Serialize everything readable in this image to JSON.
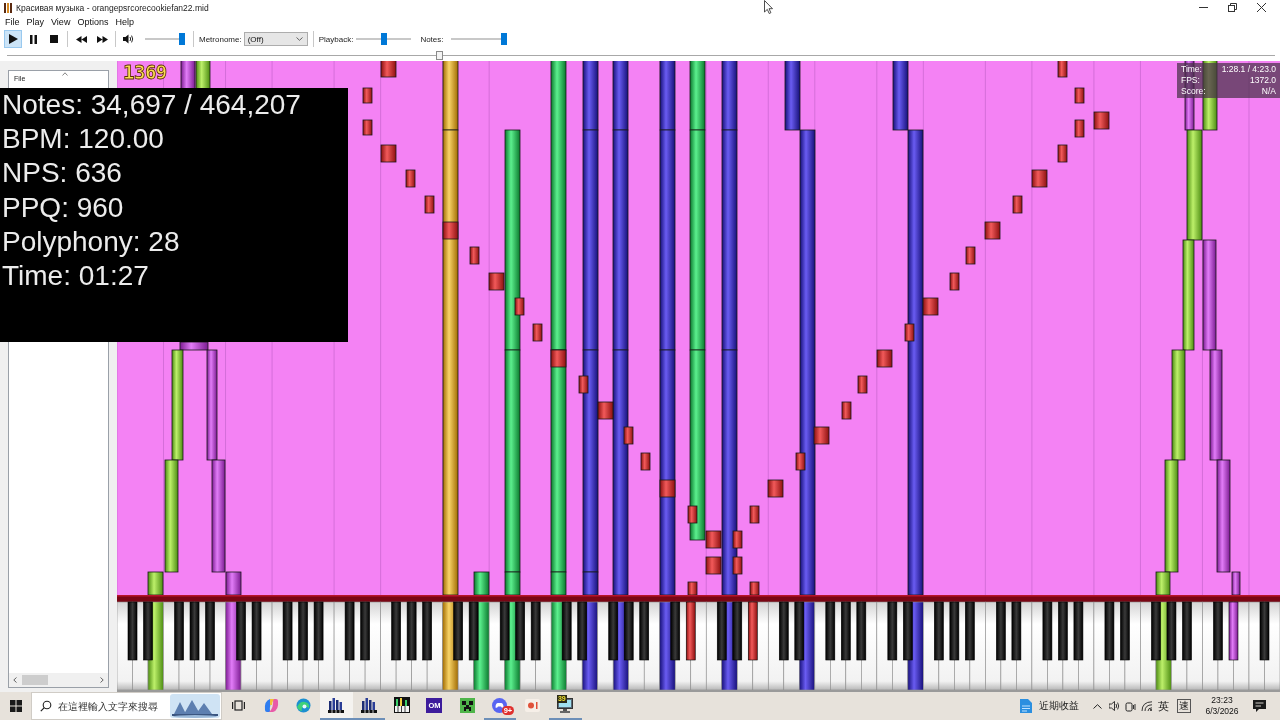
{
  "window": {
    "title": "Красивая музыка - orangepsrcorecookiefan22.mid"
  },
  "menu": [
    {
      "label": "File"
    },
    {
      "label": "Play"
    },
    {
      "label": "View"
    },
    {
      "label": "Options"
    },
    {
      "label": "Help"
    }
  ],
  "toolbar": {
    "buttons": [
      {
        "kind": "play",
        "selected": true
      },
      {
        "kind": "pause",
        "selected": false
      },
      {
        "kind": "stop",
        "selected": false
      },
      {
        "kind": "rewind",
        "selected": false
      },
      {
        "kind": "fast_forward",
        "selected": false
      }
    ],
    "volume": {
      "level": 1
    },
    "metronome": {
      "label": "Metronome:",
      "value": "(Off)"
    },
    "playback": {
      "label": "Playback:",
      "level": 0.5
    },
    "notes": {
      "label": "Notes:",
      "level": 1
    }
  },
  "seek_bar": {
    "level": 0.34
  },
  "file_list": {
    "columns": [
      {
        "label": "File"
      }
    ]
  },
  "visualizer": {
    "counter": "1369",
    "stats": [
      "Notes: 34,697 / 464,207",
      "BPM: 120.00",
      "NPS: 636",
      "PPQ: 960",
      "Polyphony: 28",
      "Time: 01:27"
    ],
    "info": [
      {
        "label": "Time:",
        "value": "1:28.1 / 4:23.0"
      },
      {
        "label": "FPS:",
        "value": "1372.0"
      },
      {
        "label": "Score:",
        "value": "N/A"
      }
    ]
  },
  "taskbar": {
    "search": {
      "placeholder": "在這裡輸入文字來搜尋"
    },
    "apps": [
      {
        "kind": "task_view",
        "running": false,
        "selected": false
      },
      {
        "kind": "swirl",
        "running": false,
        "selected": false
      },
      {
        "kind": "wave",
        "running": false,
        "selected": false
      },
      {
        "kind": "piano_bars",
        "running": true,
        "selected": true
      },
      {
        "kind": "piano_bars",
        "running": true,
        "selected": false
      },
      {
        "kind": "piano_keys",
        "running": false,
        "selected": false
      },
      {
        "kind": "tile",
        "label": "OM",
        "running": false,
        "selected": false
      },
      {
        "kind": "pixel_face",
        "running": false,
        "selected": false
      },
      {
        "kind": "gamepad",
        "badge": "9+",
        "running": true,
        "selected": false
      },
      {
        "kind": "dot_tile",
        "running": false,
        "selected": false
      },
      {
        "kind": "monitor",
        "label": "39",
        "running": true,
        "selected": false
      }
    ],
    "widget": {
      "label": "近期收益"
    },
    "tray": {
      "ime_mode": "英",
      "ime_layout": "速",
      "time": "23:23",
      "date": "6/3/2026"
    }
  }
}
